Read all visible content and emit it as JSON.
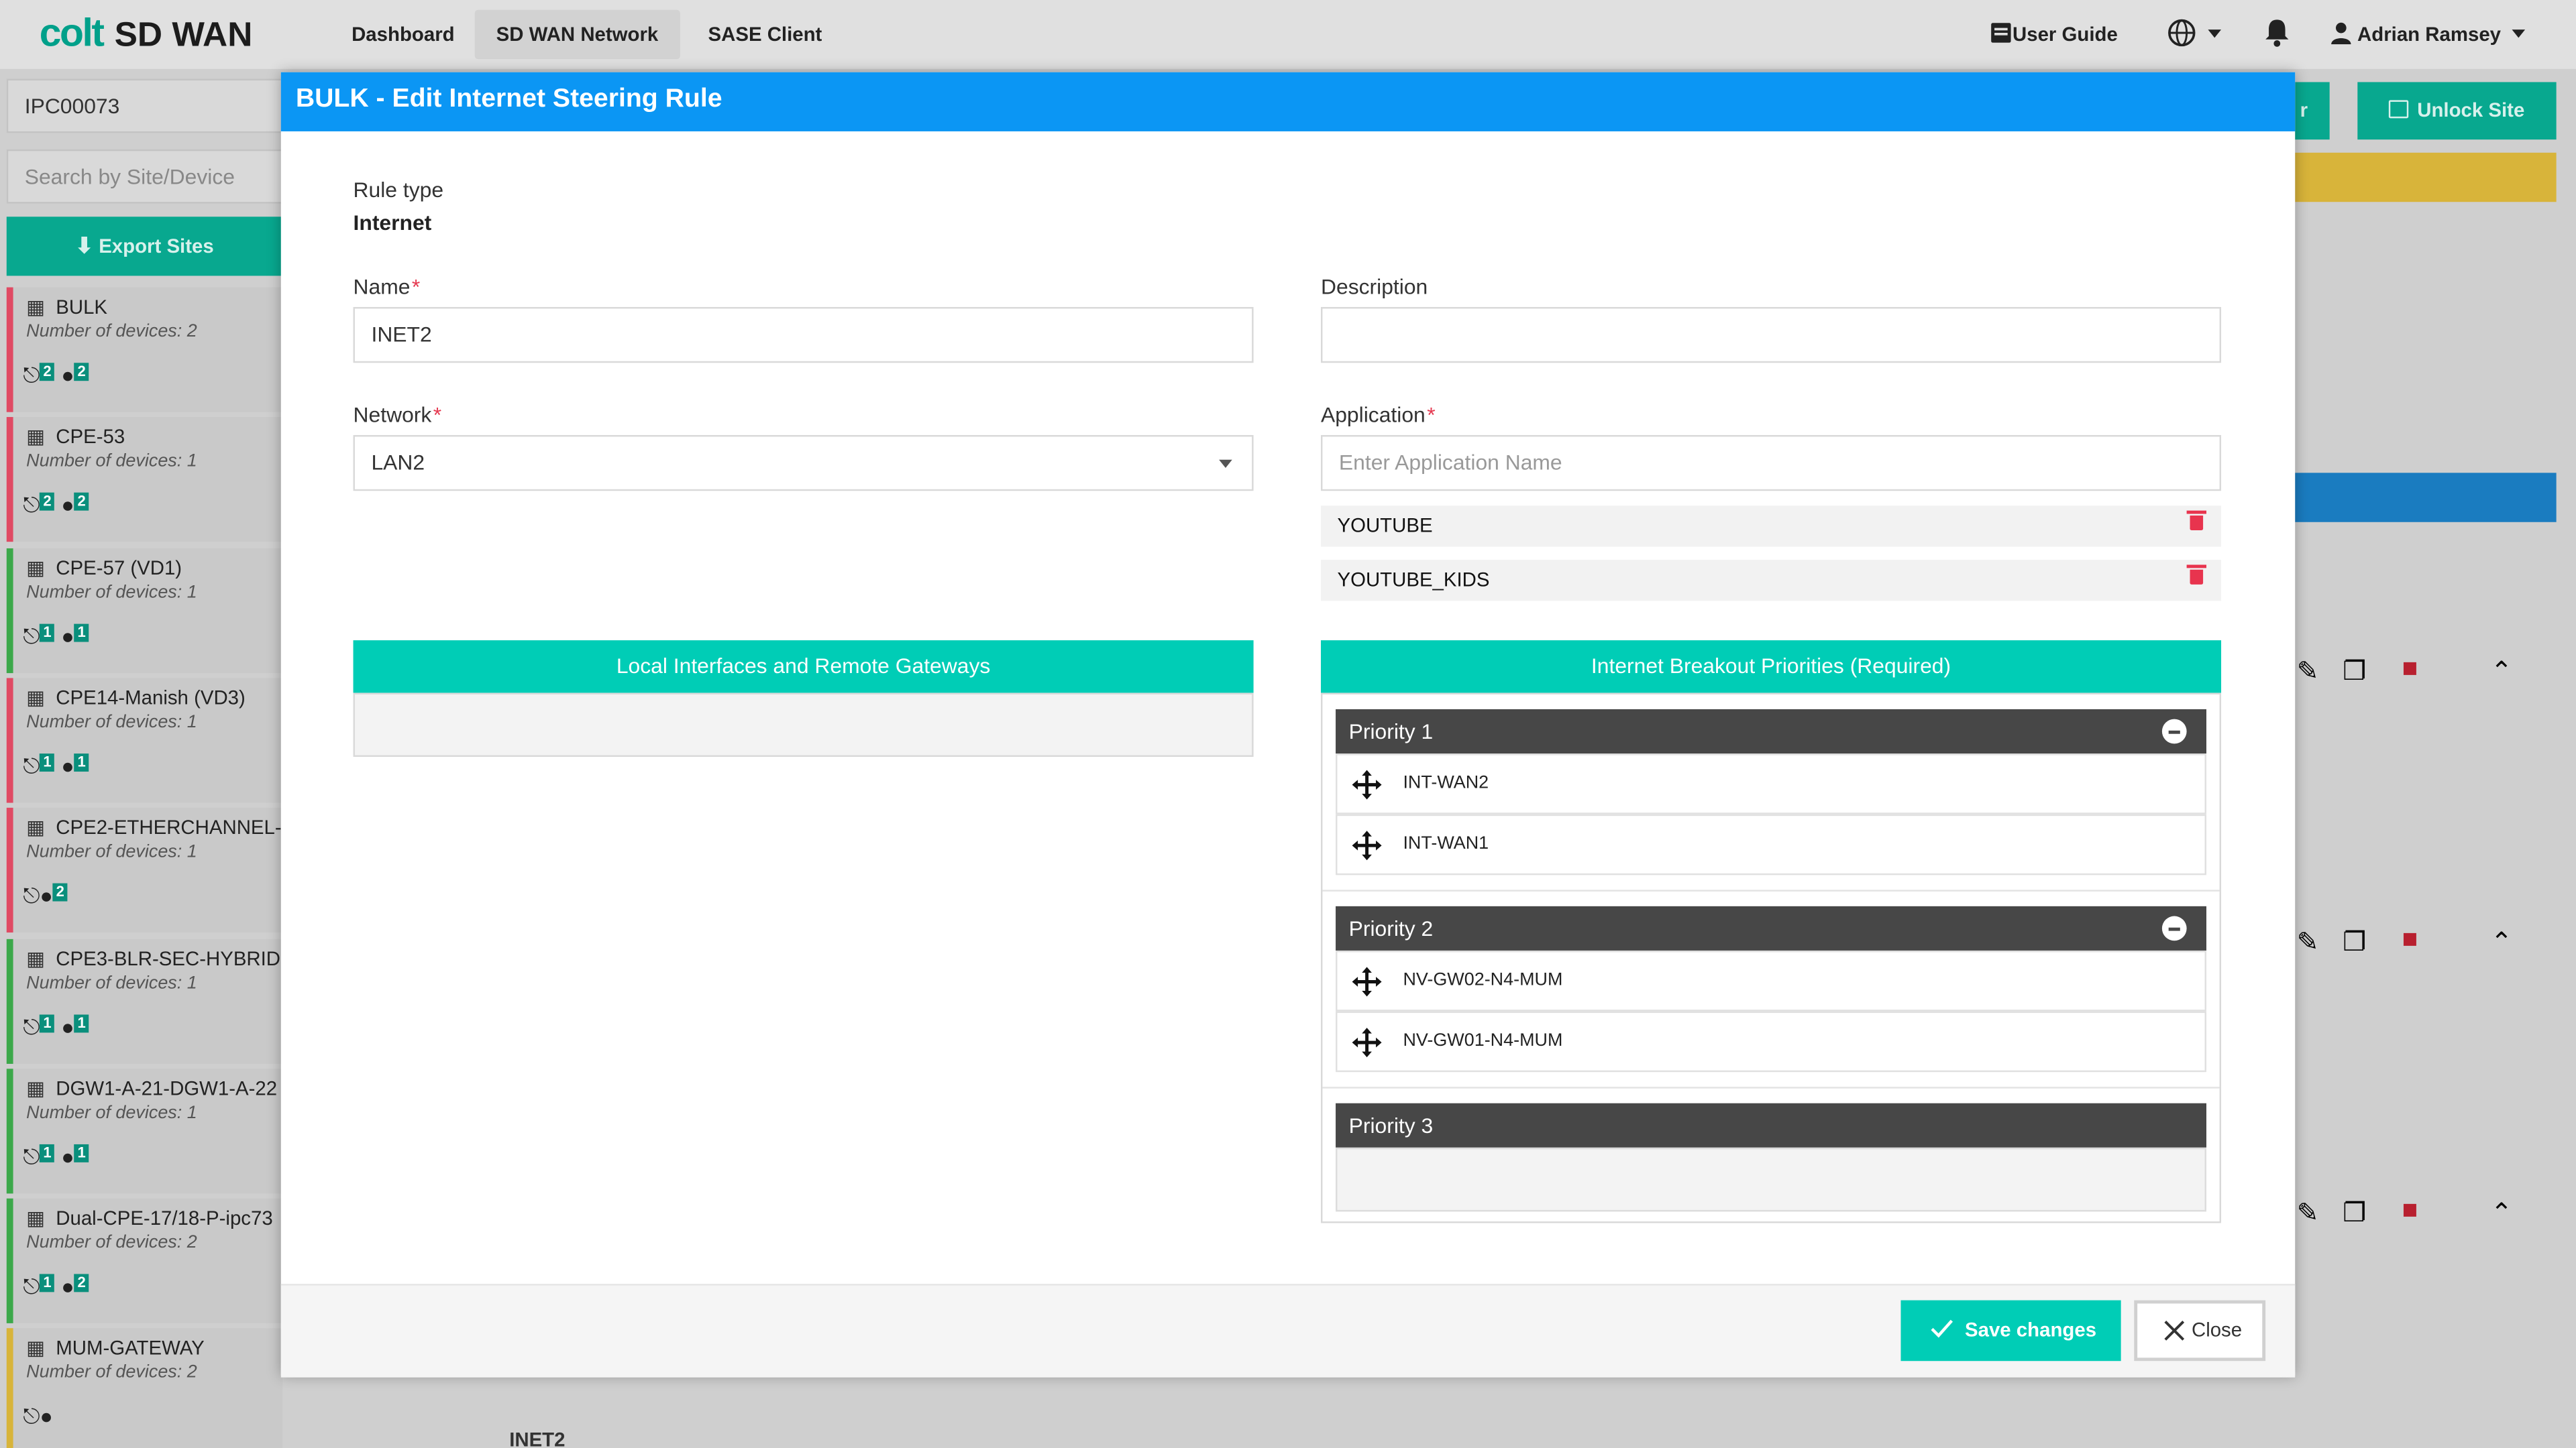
{
  "app": {
    "logo_brand": "colt",
    "logo_product": "SD WAN"
  },
  "nav": {
    "tabs": [
      {
        "label": "Dashboard"
      },
      {
        "label": "SD WAN Network"
      },
      {
        "label": "SASE Client"
      }
    ],
    "user_guide": "User Guide",
    "user_name": "Adrian Ramsey"
  },
  "background": {
    "customer_id": "IPC00073",
    "search_placeholder": "Search by Site/Device",
    "export_label": "Export Sites",
    "unlock_label": "Unlock Site",
    "partial_btn_label": "r",
    "bottom_row_label": "INET2",
    "sites": [
      {
        "name": "BULK",
        "devices": "Number of devices: 2",
        "b1": "2",
        "b2": "2"
      },
      {
        "name": "CPE-53",
        "devices": "Number of devices: 1",
        "b1": "2",
        "b2": "2"
      },
      {
        "name": "CPE-57 (VD1)",
        "devices": "Number of devices: 1",
        "b1": "1",
        "b2": "1"
      },
      {
        "name": "CPE14-Manish (VD3)",
        "devices": "Number of devices: 1",
        "b1": "1",
        "b2": "1"
      },
      {
        "name": "CPE2-ETHERCHANNEL-",
        "devices": "Number of devices: 1",
        "b1": "",
        "b2": "2"
      },
      {
        "name": "CPE3-BLR-SEC-HYBRID",
        "devices": "Number of devices: 1",
        "b1": "1",
        "b2": "1"
      },
      {
        "name": "DGW1-A-21-DGW1-A-22",
        "devices": "Number of devices: 1",
        "b1": "1",
        "b2": "1"
      },
      {
        "name": "Dual-CPE-17/18-P-ipc73",
        "devices": "Number of devices: 2",
        "b1": "1",
        "b2": "2"
      },
      {
        "name": "MUM-GATEWAY",
        "devices": "Number of devices: 2",
        "b1": "",
        "b2": ""
      }
    ]
  },
  "modal": {
    "title": "BULK - Edit Internet Steering Rule",
    "rule_type_label": "Rule type",
    "rule_type_value": "Internet",
    "name_label": "Name",
    "name_value": "INET2",
    "description_label": "Description",
    "description_value": "",
    "network_label": "Network",
    "network_value": "LAN2",
    "application_label": "Application",
    "application_placeholder": "Enter Application Name",
    "applications": [
      "YOUTUBE",
      "YOUTUBE_KIDS"
    ],
    "local_interfaces_title": "Local Interfaces and Remote Gateways",
    "breakout_title": "Internet Breakout Priorities (Required)",
    "priorities": [
      {
        "label": "Priority 1",
        "items": [
          "INT-WAN2",
          "INT-WAN1"
        ]
      },
      {
        "label": "Priority 2",
        "items": [
          "NV-GW02-N4-MUM",
          "NV-GW01-N4-MUM"
        ]
      },
      {
        "label": "Priority 3",
        "items": []
      }
    ],
    "save_label": "Save changes",
    "close_label": "Close",
    "required_mark": "*"
  },
  "colors": {
    "header_blue": "#0b96f4",
    "teal": "#00cdb6",
    "priority_dark": "#474747",
    "danger": "#e8344e"
  }
}
